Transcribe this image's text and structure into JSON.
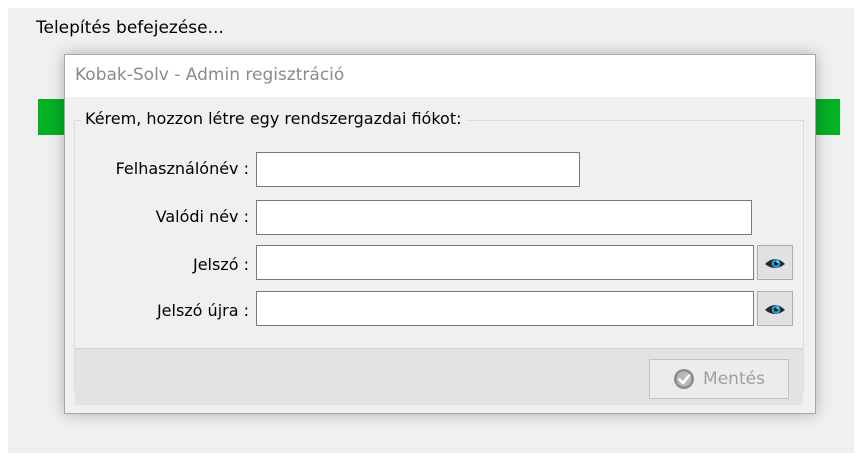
{
  "window": {
    "status_text": "Telepítés befejezése...",
    "progress_percent": 100,
    "progress_color": "#06b025"
  },
  "dialog": {
    "title": "Kobak-Solv - Admin regisztráció",
    "group_title": "Kérem, hozzon létre egy rendszergazdai fiókot:",
    "fields": [
      {
        "label": "Felhasználónév :",
        "value": ""
      },
      {
        "label": "Valódi név :",
        "value": ""
      },
      {
        "label": "Jelszó :",
        "value": ""
      },
      {
        "label": "Jelszó újra :",
        "value": ""
      }
    ],
    "eye_icon": "eye-icon",
    "save_label": "Mentés",
    "save_enabled": false,
    "save_icon": "check-shield-icon"
  }
}
